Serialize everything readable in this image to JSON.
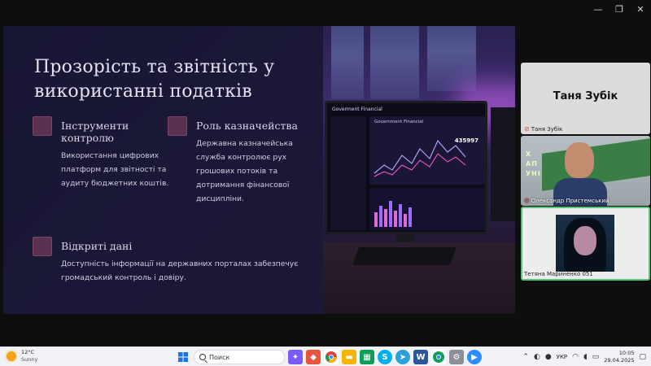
{
  "window": {
    "minimize": "—",
    "restore": "❐",
    "close": "✕"
  },
  "slide": {
    "title": "Прозорість та звітність у використанні податків",
    "cards": [
      {
        "title": "Інструменти контролю",
        "text": "Використання цифрових платформ для звітності та аудиту бюджетних коштів."
      },
      {
        "title": "Роль казначейства",
        "text": "Державна казначейська служба контролює рух грошових потоків та дотримання фінансової дисципліни."
      },
      {
        "title": "Відкриті дані",
        "text": "Доступність інформації на державних порталах забезпечує громадський контроль і довіру."
      }
    ],
    "photo": {
      "dashboard_header": "Goverment Financial",
      "panel_title": "Government Financial",
      "figure": "435997"
    }
  },
  "participants": [
    {
      "name": "Таня Зубік",
      "label": "Таня Зубік",
      "muted": true
    },
    {
      "name": "Олександр Пристемський",
      "label": "Олександр Пристемський",
      "muted": true,
      "banner_lines": [
        "Х",
        "АП",
        "УНІ"
      ]
    },
    {
      "name": "Тетяна Мариненко 051",
      "label": "Тетяна Мариненко 051",
      "muted": false
    }
  ],
  "taskbar": {
    "weather_temp": "12°C",
    "weather_desc": "Sunny",
    "search_placeholder": "Поиск",
    "language": "УКР",
    "time": "10:05",
    "date": "29.04.2025",
    "app_colors": {
      "start": "#1a73e8",
      "explorer": "#f4b400",
      "chrome": "#db4437",
      "telegram": "#2aa1da",
      "word": "#2b579a",
      "skype": "#00aff0",
      "zoom": "#2d8cff",
      "ai": "#7a5af8",
      "store": "#0f9d58"
    }
  }
}
